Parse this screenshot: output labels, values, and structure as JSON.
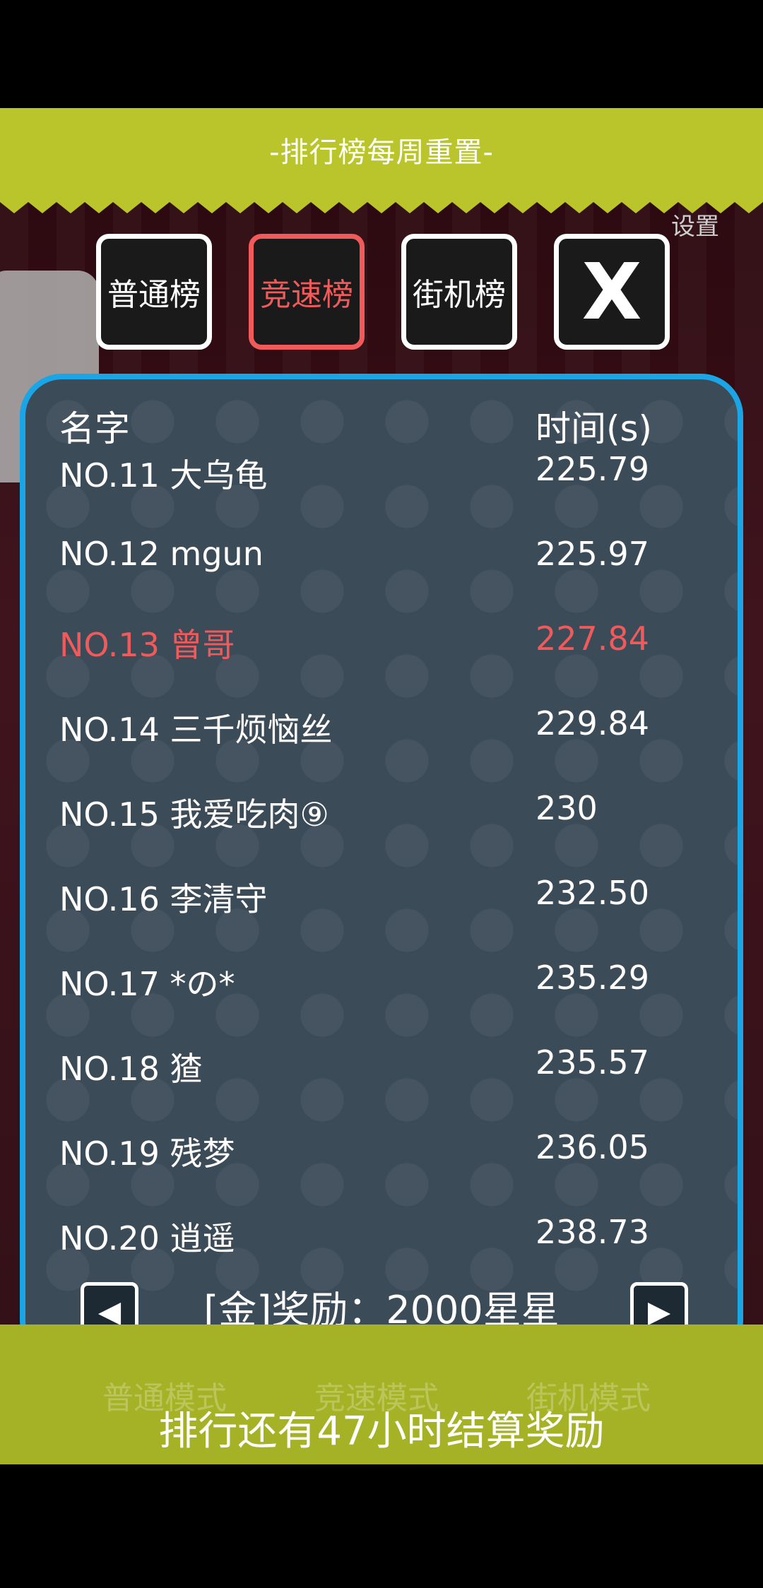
{
  "top": {
    "title": "-排行榜每周重置-",
    "settings_label": "设置"
  },
  "tabs": [
    {
      "label": "普通榜",
      "active": false
    },
    {
      "label": "竞速榜",
      "active": true
    },
    {
      "label": "街机榜",
      "active": false
    }
  ],
  "close_label": "X",
  "table": {
    "col_name": "名字",
    "col_time": "时间(s)",
    "rows": [
      {
        "name": "NO.11 大乌龟",
        "time": "225.79",
        "highlight": false
      },
      {
        "name": "NO.12 mgun",
        "time": "225.97",
        "highlight": false
      },
      {
        "name": "NO.13 曾哥",
        "time": "227.84",
        "highlight": true
      },
      {
        "name": "NO.14 三千烦恼丝",
        "time": "229.84",
        "highlight": false
      },
      {
        "name": "NO.15 我爱吃肉⑨",
        "time": "230",
        "highlight": false
      },
      {
        "name": "NO.16 李清守",
        "time": "232.50",
        "highlight": false
      },
      {
        "name": "NO.17 *の*",
        "time": "235.29",
        "highlight": false
      },
      {
        "name": "NO.18 猹",
        "time": "235.57",
        "highlight": false
      },
      {
        "name": "NO.19 残梦",
        "time": "236.05",
        "highlight": false
      },
      {
        "name": "NO.20 逍遥",
        "time": "238.73",
        "highlight": false
      }
    ]
  },
  "reward_text": "[金]奖励：2000星星",
  "prev_icon": "◀",
  "next_icon": "▶",
  "bottom": {
    "modes": [
      "普通模式",
      "竞速模式",
      "街机模式"
    ],
    "countdown": "排行还有47小时结算奖励"
  },
  "colors": {
    "accent_red": "#f05a5a",
    "panel_border": "#1aa5e6",
    "band_green": "#b9c52a"
  }
}
